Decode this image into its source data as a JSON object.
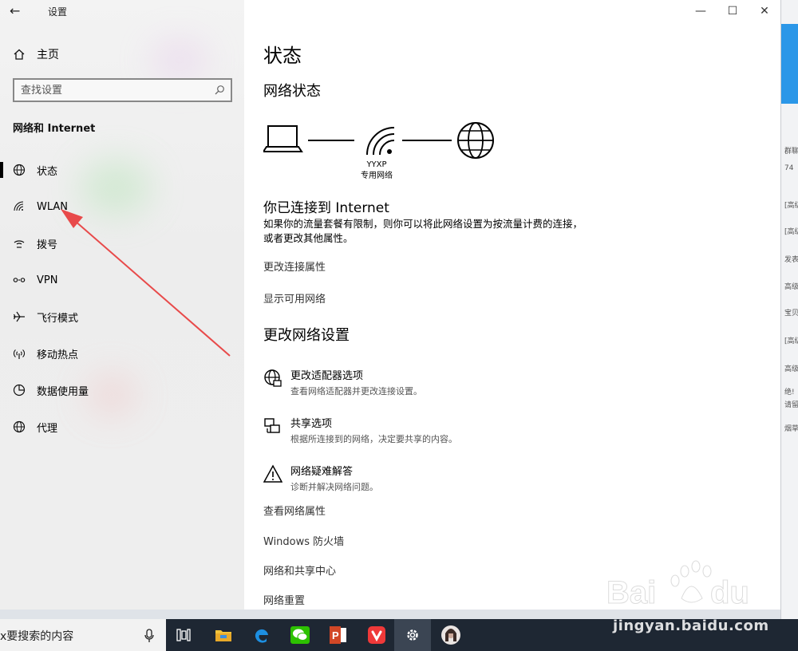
{
  "window": {
    "title": "设置"
  },
  "sidebar": {
    "home_label": "主页",
    "search_placeholder": "查找设置",
    "section_title": "网络和 Internet",
    "items": [
      {
        "label": "状态",
        "icon": "globe-icon",
        "active": true
      },
      {
        "label": "WLAN",
        "icon": "wifi-icon",
        "active": false
      },
      {
        "label": "拨号",
        "icon": "dialup-icon",
        "active": false
      },
      {
        "label": "VPN",
        "icon": "vpn-icon",
        "active": false
      },
      {
        "label": "飞行模式",
        "icon": "airplane-icon",
        "active": false
      },
      {
        "label": "移动热点",
        "icon": "hotspot-icon",
        "active": false
      },
      {
        "label": "数据使用量",
        "icon": "data-usage-icon",
        "active": false
      },
      {
        "label": "代理",
        "icon": "proxy-globe-icon",
        "active": false
      }
    ]
  },
  "main": {
    "page_title": "状态",
    "network_status_heading": "网络状态",
    "network_name": "YYXP",
    "network_type": "专用网络",
    "connected_heading": "你已连接到 Internet",
    "connected_desc": "如果你的流量套餐有限制，则你可以将此网络设置为按流量计费的连接，或者更改其他属性。",
    "links_top": [
      "更改连接属性",
      "显示可用网络"
    ],
    "change_settings_heading": "更改网络设置",
    "options": [
      {
        "title": "更改适配器选项",
        "desc": "查看网络适配器并更改连接设置。",
        "icon": "adapter-globe-icon"
      },
      {
        "title": "共享选项",
        "desc": "根据所连接到的网络，决定要共享的内容。",
        "icon": "sharing-icon"
      },
      {
        "title": "网络疑难解答",
        "desc": "诊断并解决网络问题。",
        "icon": "warning-triangle-icon"
      }
    ],
    "links_bottom": [
      "查看网络属性",
      "Windows 防火墙",
      "网络和共享中心",
      "网络重置"
    ]
  },
  "taskbar": {
    "search_text": "x要搜索的内容",
    "apps": [
      "task-view-icon",
      "file-explorer-icon",
      "edge-icon",
      "wechat-icon",
      "powerpoint-icon",
      "vivaldi-icon",
      "settings-gear-icon",
      "avatar-photo-icon"
    ]
  },
  "background_app": {
    "fragments": [
      "群聊",
      "74",
      "[高级",
      "[高级",
      "发表",
      "高级设",
      "宝贝",
      "[高级",
      "高级设",
      "绝!",
      "请留",
      "烟草"
    ]
  },
  "watermark": {
    "text": "jingyan.baidu.com"
  },
  "colors": {
    "accent": "#0078d7",
    "arrow": "#e84a4a",
    "taskbar": "#1e2733"
  }
}
